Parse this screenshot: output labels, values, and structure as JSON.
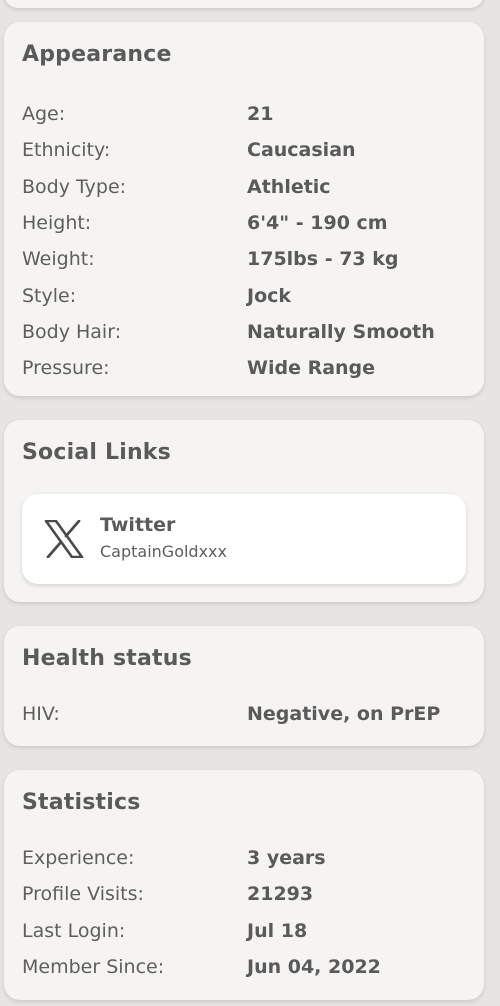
{
  "appearance": {
    "title": "Appearance",
    "rows": [
      {
        "label": "Age:",
        "value": "21"
      },
      {
        "label": "Ethnicity:",
        "value": "Caucasian"
      },
      {
        "label": "Body Type:",
        "value": "Athletic"
      },
      {
        "label": "Height:",
        "value": "6'4\" - 190 cm"
      },
      {
        "label": "Weight:",
        "value": "175lbs - 73 kg"
      },
      {
        "label": "Style:",
        "value": "Jock"
      },
      {
        "label": "Body Hair:",
        "value": "Naturally Smooth"
      },
      {
        "label": "Pressure:",
        "value": "Wide Range"
      }
    ]
  },
  "social": {
    "title": "Social Links",
    "items": [
      {
        "icon": "x-twitter-icon",
        "name": "Twitter",
        "handle": "CaptainGoldxxx"
      }
    ]
  },
  "health": {
    "title": "Health status",
    "rows": [
      {
        "label": "HIV:",
        "value": "Negative, on PrEP"
      }
    ]
  },
  "statistics": {
    "title": "Statistics",
    "rows": [
      {
        "label": "Experience:",
        "value": "3 years"
      },
      {
        "label": "Profile Visits:",
        "value": "21293"
      },
      {
        "label": "Last Login:",
        "value": "Jul 18"
      },
      {
        "label": "Member Since:",
        "value": "Jun 04, 2022"
      }
    ]
  },
  "colors": {
    "page_background": "#e6e5e1",
    "card_background": "#f5f4f2",
    "text": "#5a5a5a"
  }
}
